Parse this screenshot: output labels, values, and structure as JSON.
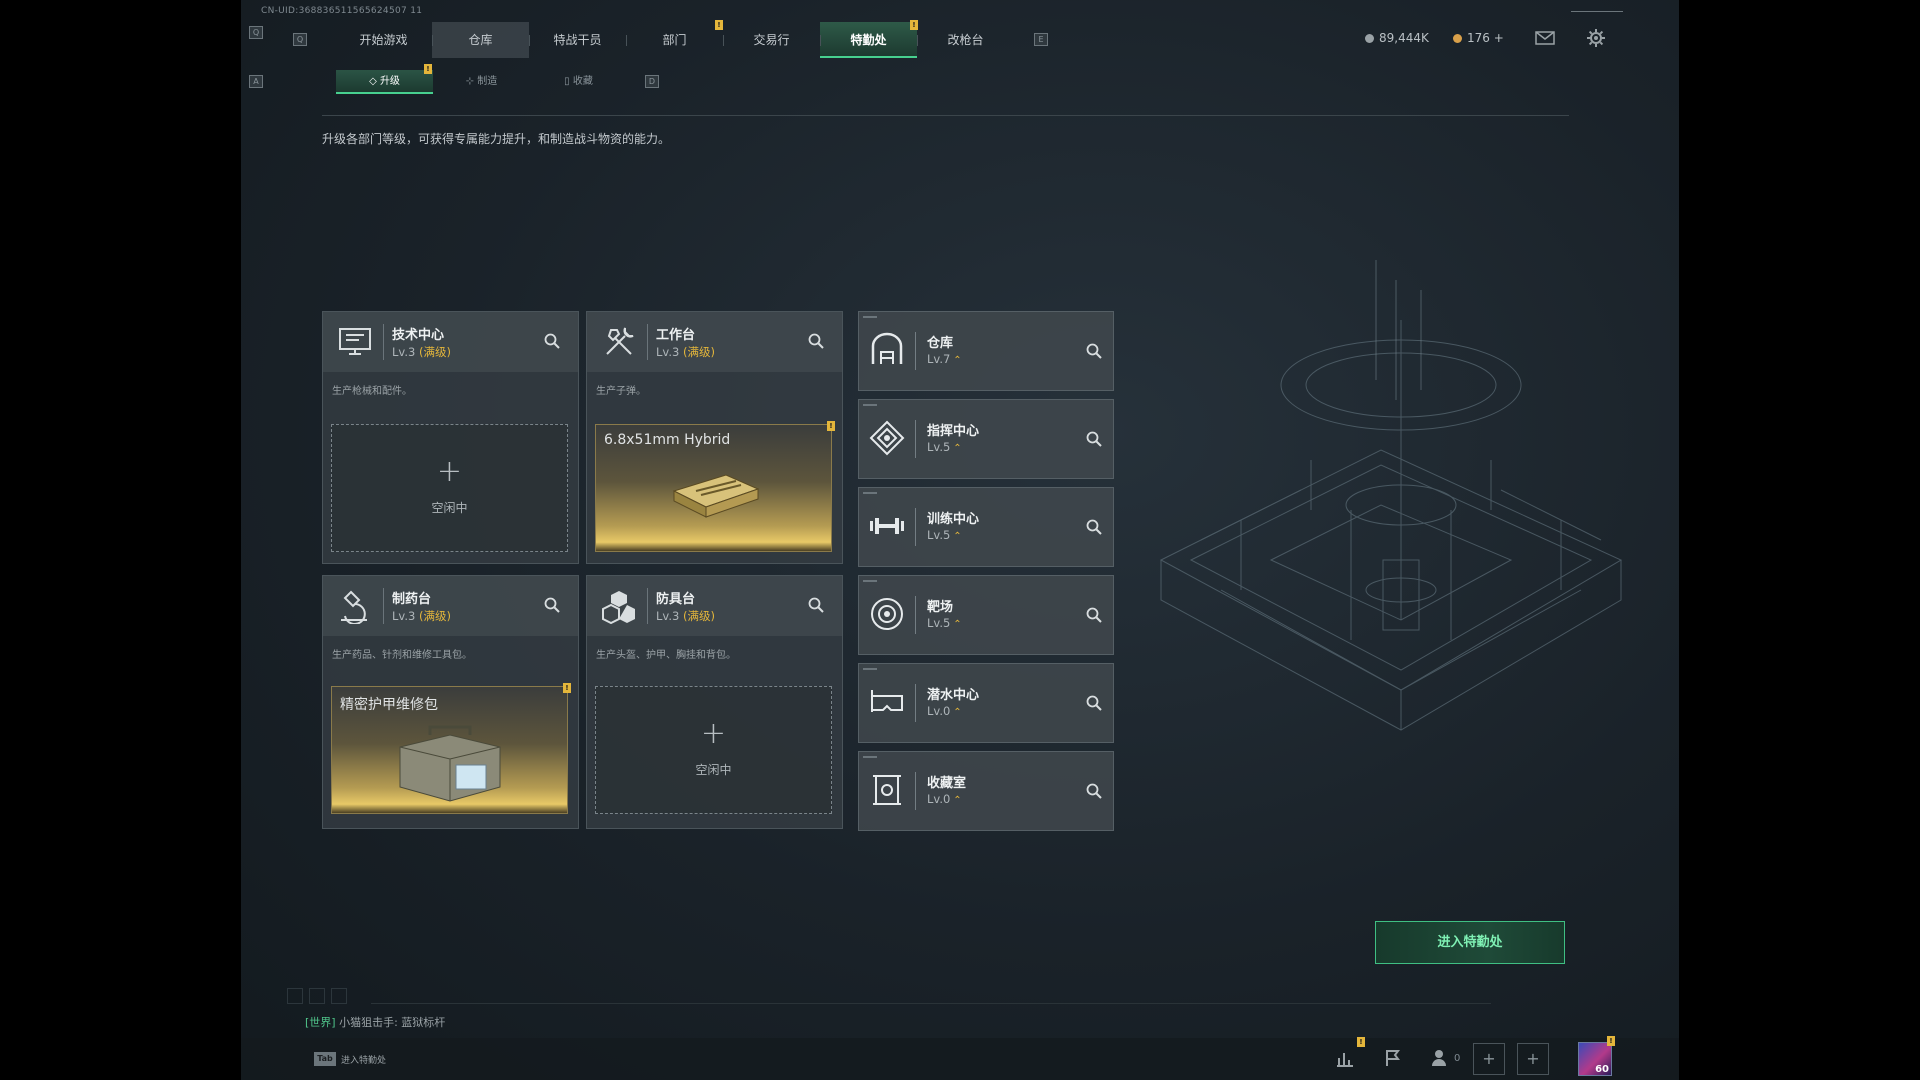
{
  "uid": "CN-UID:368836511565624507 11",
  "nav": {
    "left_key": "Q",
    "right_key": "E",
    "tabs": [
      {
        "label": "开始游戏"
      },
      {
        "label": "仓库"
      },
      {
        "label": "特战干员"
      },
      {
        "label": "部门"
      },
      {
        "label": "交易行"
      },
      {
        "label": "特勤处"
      },
      {
        "label": "改枪台"
      }
    ],
    "active_tab": "特勤处"
  },
  "currency": {
    "primary": "89,444K",
    "secondary": "176 +"
  },
  "subnav": {
    "left_key": "A",
    "right_key": "D",
    "tabs": [
      {
        "label": "升级"
      },
      {
        "label": "制造"
      },
      {
        "label": "收藏"
      }
    ]
  },
  "description": "升级各部门等级，可获得专属能力提升，和制造战斗物资的能力。",
  "production_cards": [
    {
      "name": "技术中心",
      "level": "Lv.3",
      "max": "(满级)",
      "desc": "生产枪械和配件。",
      "slot": {
        "state": "empty",
        "plus": "+",
        "label": "空闲中"
      }
    },
    {
      "name": "工作台",
      "level": "Lv.3",
      "max": "(满级)",
      "desc": "生产子弹。",
      "slot": {
        "state": "item",
        "item": "6.8x51mm Hybrid"
      }
    },
    {
      "name": "制药台",
      "level": "Lv.3",
      "max": "(满级)",
      "desc": "生产药品、针剂和维修工具包。",
      "slot": {
        "state": "item",
        "item": "精密护甲维修包"
      }
    },
    {
      "name": "防具台",
      "level": "Lv.3",
      "max": "(满级)",
      "desc": "生产头盔、护甲、胸挂和背包。",
      "slot": {
        "state": "empty",
        "plus": "+",
        "label": "空闲中"
      }
    }
  ],
  "facilities": [
    {
      "name": "仓库",
      "level": "Lv.7",
      "icon": "warehouse-icon"
    },
    {
      "name": "指挥中心",
      "level": "Lv.5",
      "icon": "command-center-icon"
    },
    {
      "name": "训练中心",
      "level": "Lv.5",
      "icon": "dumbbell-icon"
    },
    {
      "name": "靶场",
      "level": "Lv.5",
      "icon": "target-icon"
    },
    {
      "name": "潜水中心",
      "level": "Lv.0",
      "icon": "diving-mask-icon"
    },
    {
      "name": "收藏室",
      "level": "Lv.0",
      "icon": "collection-icon"
    }
  ],
  "upgrade_arrow": "⌃",
  "enter_button": "进入特勤处",
  "chat": {
    "channel": "[世界]",
    "message": "小猫狙击手: 蓝狱标杆"
  },
  "bottom": {
    "tab_key": "Tab",
    "tab_hint": "进入特勤处",
    "friends_count": "0",
    "avatar_level": "60"
  },
  "colors": {
    "accent": "#47d08f",
    "badge": "#e4b63b",
    "max_level": "#e4b63b"
  }
}
